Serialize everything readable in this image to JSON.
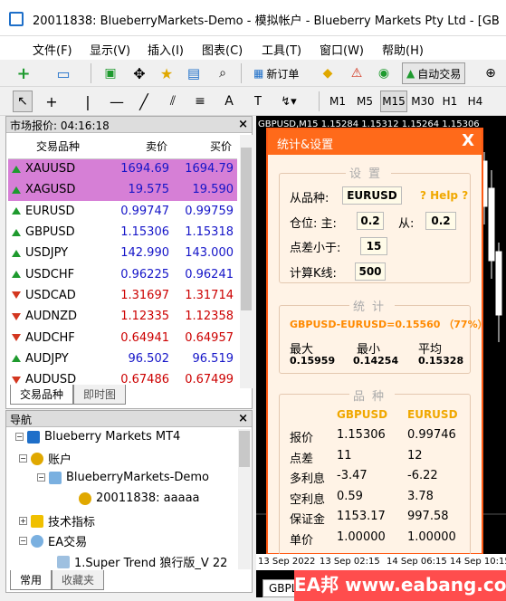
{
  "window": {
    "title": "20011838: BlueberryMarkets-Demo - 模拟帐户 - Blueberry Markets Pty Ltd - [GB"
  },
  "menu": [
    "文件(F)",
    "显示(V)",
    "插入(I)",
    "图表(C)",
    "工具(T)",
    "窗口(W)",
    "帮助(H)"
  ],
  "toolbar": {
    "new_order": "新订单",
    "auto_trade": "自动交易",
    "timeframes": [
      "M1",
      "M5",
      "M15",
      "M30",
      "H1",
      "H4"
    ]
  },
  "market_watch": {
    "title": "市场报价: 04:16:18",
    "columns": [
      "交易品种",
      "卖价",
      "买价"
    ],
    "rows": [
      {
        "symbol": "XAUUSD",
        "bid": "1694.69",
        "ask": "1694.79",
        "dir": "up"
      },
      {
        "symbol": "XAGUSD",
        "bid": "19.575",
        "ask": "19.590",
        "dir": "up"
      },
      {
        "symbol": "EURUSD",
        "bid": "0.99747",
        "ask": "0.99759",
        "dir": "up"
      },
      {
        "symbol": "GBPUSD",
        "bid": "1.15306",
        "ask": "1.15318",
        "dir": "up"
      },
      {
        "symbol": "USDJPY",
        "bid": "142.990",
        "ask": "143.000",
        "dir": "up"
      },
      {
        "symbol": "USDCHF",
        "bid": "0.96225",
        "ask": "0.96241",
        "dir": "up"
      },
      {
        "symbol": "USDCAD",
        "bid": "1.31697",
        "ask": "1.31714",
        "dir": "down"
      },
      {
        "symbol": "AUDNZD",
        "bid": "1.12335",
        "ask": "1.12358",
        "dir": "down"
      },
      {
        "symbol": "AUDCHF",
        "bid": "0.64941",
        "ask": "0.64957",
        "dir": "down"
      },
      {
        "symbol": "AUDJPY",
        "bid": "96.502",
        "ask": "96.519",
        "dir": "up"
      },
      {
        "symbol": "AUDUSD",
        "bid": "0.67486",
        "ask": "0.67499",
        "dir": "down"
      }
    ],
    "tabs": [
      "交易品种",
      "即时图"
    ]
  },
  "navigator": {
    "title": "导航",
    "items": [
      "Blueberry Markets MT4",
      "账户",
      "BlueberryMarkets-Demo",
      "20011838: aaaaa",
      "技术指标",
      "EA交易",
      "1.Super Trend 狼行版_V 22"
    ],
    "tabs": [
      "常用",
      "收藏夹"
    ]
  },
  "chart": {
    "title": "GBPUSD,M15  1.15284 1.15312 1.15264 1.15306",
    "time1": "13 Sep 2022",
    "time2": "13 Sep 02:15",
    "time3": "14 Sep 06:15",
    "time4": "14 Sep 10:15",
    "tab": "GBPL"
  },
  "dialog": {
    "title": "统计&设置",
    "close": "X",
    "settings_label": "设置",
    "from_symbol_label": "从品种:",
    "from_symbol": "EURUSD",
    "help": "? Help ?",
    "position_main_label": "仓位: 主:",
    "position_main": "0.2",
    "position_sub_label": "从:",
    "position_sub": "0.2",
    "spread_label": "点差小于:",
    "spread": "15",
    "kline_label": "计算K线:",
    "kline": "500",
    "stats_label": "统计",
    "stats_line": "GBPUSD-EURUSD=0.15560 （77%）",
    "max_label": "最大",
    "min_label": "最小",
    "avg_label": "平均",
    "max": "0.15959",
    "min": "0.14254",
    "avg": "0.15328",
    "symbols_label": "品种",
    "sym1": "GBPUSD",
    "sym2": "EURUSD",
    "rows": [
      {
        "label": "报价",
        "a": "1.15306",
        "b": "0.99746"
      },
      {
        "label": "点差",
        "a": "11",
        "b": "12"
      },
      {
        "label": "多利息",
        "a": "-3.47",
        "b": "-6.22"
      },
      {
        "label": "空利息",
        "a": "0.59",
        "b": "3.78"
      },
      {
        "label": "保证金",
        "a": "1153.17",
        "b": "997.58"
      },
      {
        "label": "单价",
        "a": "1.00000",
        "b": "1.00000"
      }
    ]
  },
  "watermark": "EA邦 www.eabang.com"
}
